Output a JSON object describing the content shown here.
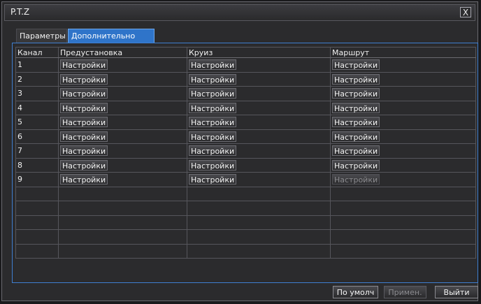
{
  "window": {
    "title": "P.T.Z",
    "close_label": "X"
  },
  "tabs": [
    {
      "label": "Параметры",
      "active": false
    },
    {
      "label": "Дополнительно",
      "active": true
    }
  ],
  "table": {
    "headers": [
      "Канал",
      "Предустановка",
      "Круиз",
      "Маршрут"
    ],
    "button_label": "Настройки",
    "rows": [
      {
        "channel": "1",
        "preset": "Настройки",
        "cruise": "Настройки",
        "route": "Настройки",
        "route_enabled": true
      },
      {
        "channel": "2",
        "preset": "Настройки",
        "cruise": "Настройки",
        "route": "Настройки",
        "route_enabled": true
      },
      {
        "channel": "3",
        "preset": "Настройки",
        "cruise": "Настройки",
        "route": "Настройки",
        "route_enabled": true
      },
      {
        "channel": "4",
        "preset": "Настройки",
        "cruise": "Настройки",
        "route": "Настройки",
        "route_enabled": true
      },
      {
        "channel": "5",
        "preset": "Настройки",
        "cruise": "Настройки",
        "route": "Настройки",
        "route_enabled": true
      },
      {
        "channel": "6",
        "preset": "Настройки",
        "cruise": "Настройки",
        "route": "Настройки",
        "route_enabled": true
      },
      {
        "channel": "7",
        "preset": "Настройки",
        "cruise": "Настройки",
        "route": "Настройки",
        "route_enabled": true
      },
      {
        "channel": "8",
        "preset": "Настройки",
        "cruise": "Настройки",
        "route": "Настройки",
        "route_enabled": true
      },
      {
        "channel": "9",
        "preset": "Настройки",
        "cruise": "Настройки",
        "route": "Настройки",
        "route_enabled": false
      }
    ],
    "empty_rows": 5
  },
  "footer": {
    "default_label": "По умолч",
    "apply_label": "Примен.",
    "exit_label": "Выйти"
  },
  "colors": {
    "accent": "#2f74c9",
    "panel_border": "#3f7fd1",
    "background": "#2b2b2d"
  }
}
